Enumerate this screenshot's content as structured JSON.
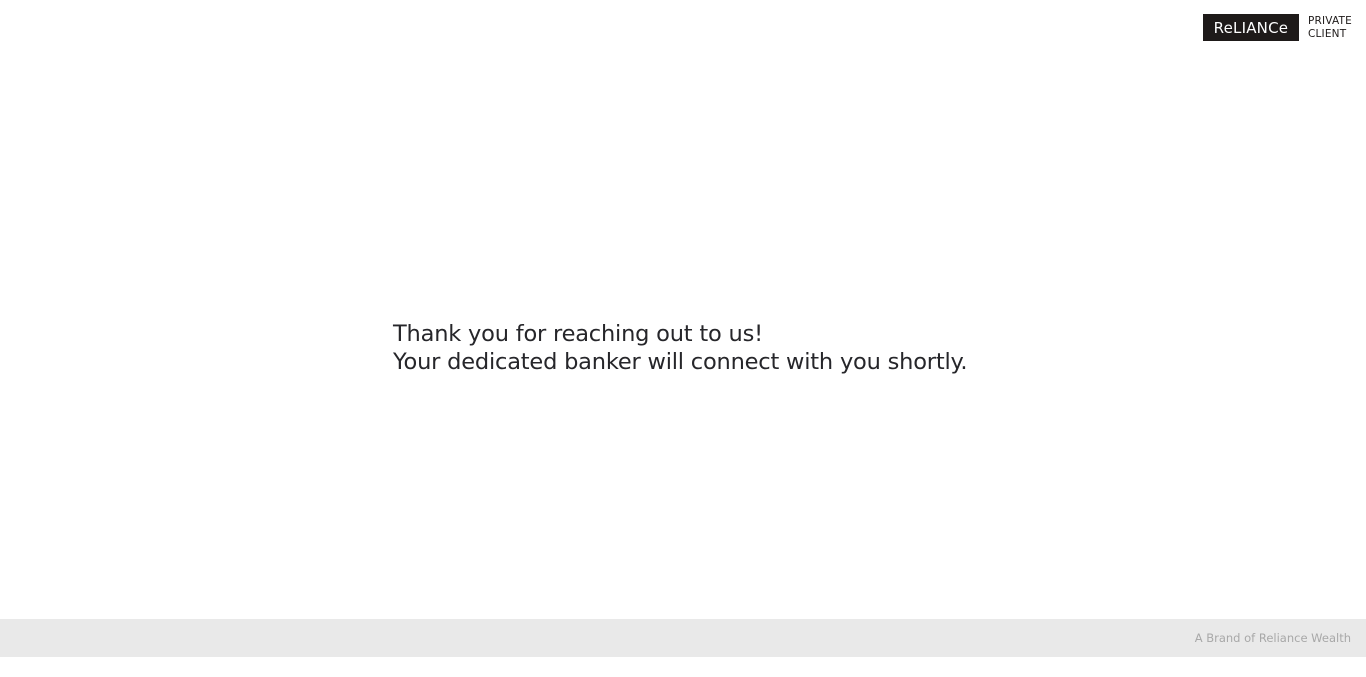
{
  "header": {
    "logo": {
      "wordmark": "ReLIANCe",
      "line1": "PRIVATE",
      "line2": "CLIENT"
    }
  },
  "main": {
    "line1": "Thank you for reaching out to us!",
    "line2": "Your dedicated banker will connect with you shortly."
  },
  "footer": {
    "tagline": "A Brand of Reliance Wealth"
  },
  "colors": {
    "logo_bg": "#1e1a19",
    "text": "#26262a",
    "footer_bg": "#e9e9e9",
    "footer_text": "#a8a8a8"
  }
}
